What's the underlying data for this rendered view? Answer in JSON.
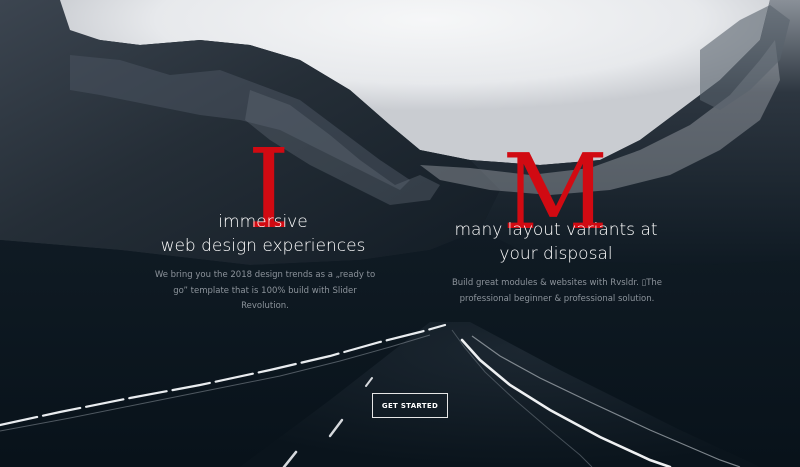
{
  "hero": {
    "letter_left": "I",
    "letter_right": "M",
    "heading_left": [
      "immersive",
      "web design experiences"
    ],
    "heading_right": [
      "many layout variants at",
      "your disposal"
    ],
    "paragraph_left": "We bring you the 2018 design trends as a „ready to go” template that is 100% build with Slider Revolution.",
    "paragraph_right": "Build great modules & websites with Rvsldr. ▯The professional beginner & professional solution.",
    "cta_label": "GET STARTED"
  },
  "colors": {
    "background": "#0b1620",
    "sky": "#eeeff1",
    "accent_red": "#d10a12",
    "heading_text": "#ffffff",
    "body_text": "#8c939b"
  }
}
